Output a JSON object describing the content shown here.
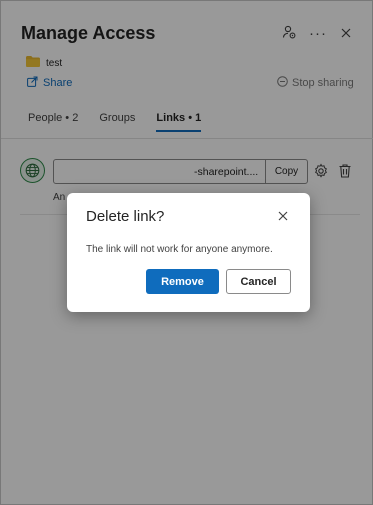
{
  "panel": {
    "title": "Manage Access",
    "header_icons": [
      "manage-people-icon",
      "more-options-icon",
      "close-icon"
    ],
    "file": {
      "name": "test",
      "icon": "folder-icon",
      "icon_color": "#e8b730"
    },
    "share_label": "Share",
    "stop_sharing_label": "Stop sharing"
  },
  "tabs": [
    {
      "label": "People • 2",
      "active": false
    },
    {
      "label": "Groups",
      "active": false
    },
    {
      "label": "Links • 1",
      "active": true
    }
  ],
  "link": {
    "icon": "globe-icon",
    "url_visible": "-sharepoint....",
    "copy_label": "Copy",
    "description_partial": "An"
  },
  "dialog": {
    "title": "Delete link?",
    "message": "The link will not work for anyone anymore.",
    "remove_label": "Remove",
    "cancel_label": "Cancel"
  },
  "colors": {
    "accent": "#0f6cbd",
    "overlay": "rgba(0,0,0,0.40)"
  }
}
